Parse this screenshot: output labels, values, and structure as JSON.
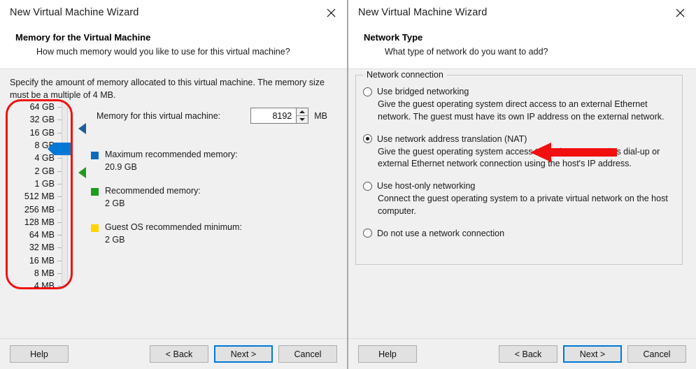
{
  "left_window": {
    "title": "New Virtual Machine Wizard",
    "close_icon": "close-icon",
    "heading": "Memory for the Virtual Machine",
    "subheading": "How much memory would you like to use for this virtual machine?",
    "intro": "Specify the amount of memory allocated to this virtual machine. The memory size must be a multiple of 4 MB.",
    "slider": {
      "ticks": [
        "64 GB",
        "32 GB",
        "16 GB",
        "8 GB",
        "4 GB",
        "2 GB",
        "1 GB",
        "512 MB",
        "256 MB",
        "128 MB",
        "64 MB",
        "32 MB",
        "16 MB",
        "8 MB",
        "4 MB"
      ],
      "thumb_label": "8 GB",
      "max_marker_label": "16 GB",
      "recommended_marker_label": "2 GB"
    },
    "memory_field": {
      "label": "Memory for this virtual machine:",
      "value": "8192",
      "unit": "MB"
    },
    "legend": [
      {
        "color": "#0f6cbd",
        "title": "Maximum recommended memory:",
        "value": "20.9 GB"
      },
      {
        "color": "#1f9b1f",
        "title": "Recommended memory:",
        "value": "2 GB"
      },
      {
        "color": "#ffd400",
        "title": "Guest OS recommended minimum:",
        "value": "2 GB"
      }
    ],
    "footer": {
      "help": "Help",
      "back": "< Back",
      "next": "Next >",
      "cancel": "Cancel"
    }
  },
  "right_window": {
    "title": "New Virtual Machine Wizard",
    "close_icon": "close-icon",
    "heading": "Network Type",
    "subheading": "What type of network do you want to add?",
    "group_title": "Network connection",
    "options": [
      {
        "label": "Use bridged networking",
        "description": "Give the guest operating system direct access to an external Ethernet network. The guest must have its own IP address on the external network.",
        "selected": false
      },
      {
        "label": "Use network address translation (NAT)",
        "description": "Give the guest operating system access to the host computer's dial-up or external Ethernet network connection using the host's IP address.",
        "selected": true
      },
      {
        "label": "Use host-only networking",
        "description": "Connect the guest operating system to a private virtual network on the host computer.",
        "selected": false
      },
      {
        "label": "Do not use a network connection",
        "description": "",
        "selected": false
      }
    ],
    "footer": {
      "help": "Help",
      "back": "< Back",
      "next": "Next >",
      "cancel": "Cancel"
    }
  },
  "annotations": {
    "highlight_color": "#f01010",
    "slider_highlight": "memory-slider-highlight",
    "nat_arrow": "nat-option-arrow"
  }
}
